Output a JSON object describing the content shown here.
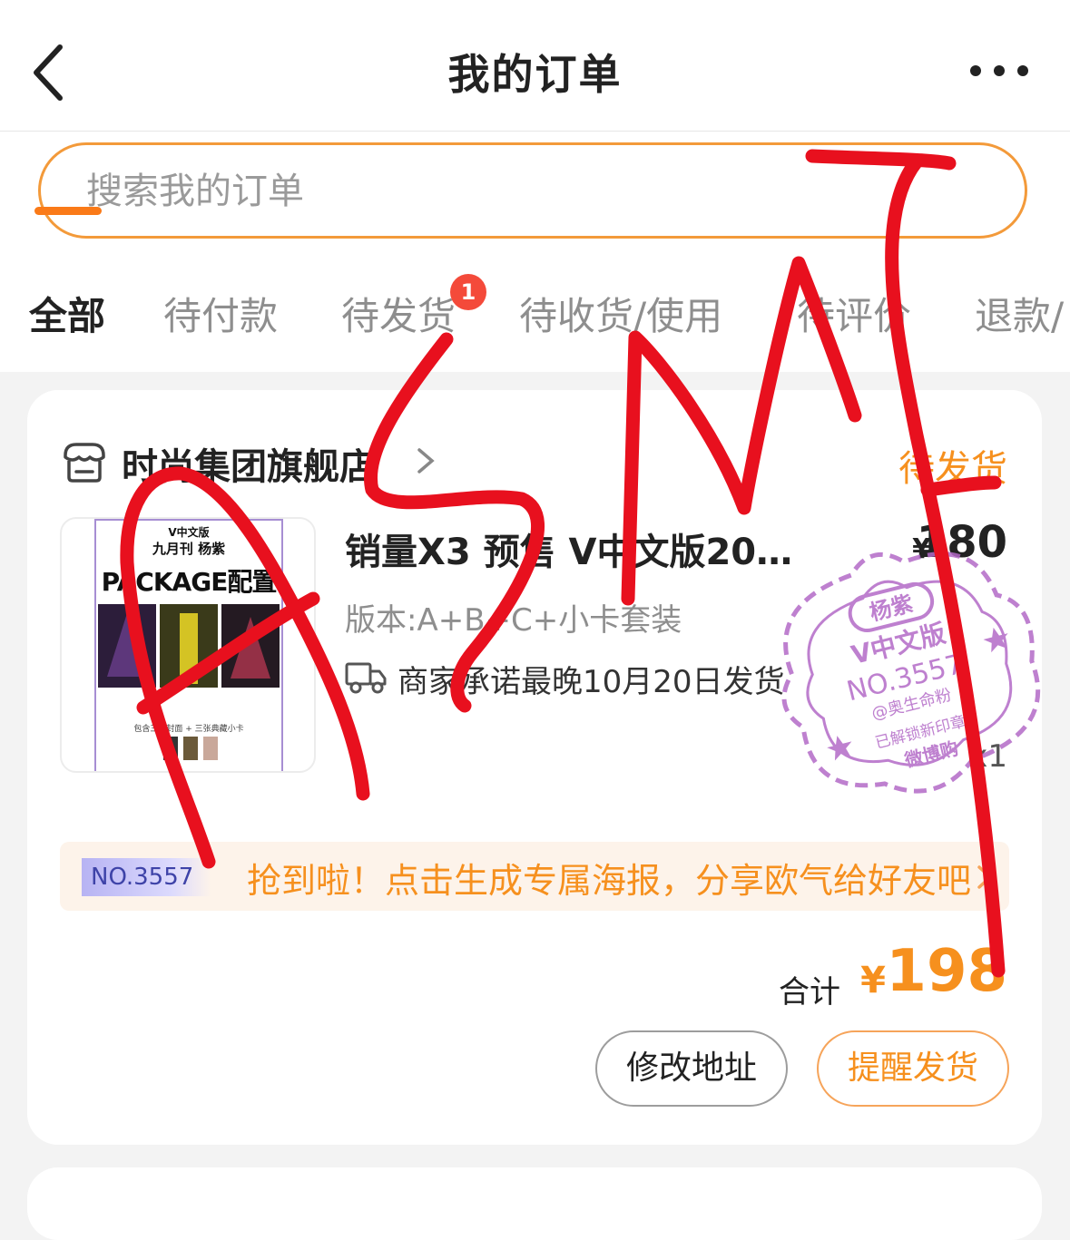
{
  "header": {
    "title": "我的订单",
    "back_icon": "chevron-left-icon",
    "more_icon": "more-dots-icon"
  },
  "search": {
    "placeholder": "搜索我的订单",
    "value": ""
  },
  "tabs": [
    {
      "label": "全部",
      "active": true
    },
    {
      "label": "待付款",
      "active": false
    },
    {
      "label": "待发货",
      "active": false,
      "badge": "1"
    },
    {
      "label": "待收货/使用",
      "active": false
    },
    {
      "label": "待评价",
      "active": false
    },
    {
      "label": "退款/",
      "active": false
    }
  ],
  "order": {
    "shop_name": "时尚集团旗舰店",
    "status": "待发货",
    "product": {
      "title": "销量X3 预售 V中文版20…",
      "price_unit": "¥",
      "price": "180",
      "spec": "版本:A+B+C+小卡套装",
      "shipping_note": "商家承诺最晚10月20日发货",
      "quantity": "x1",
      "poster": {
        "line1": "V中文版",
        "line2": "九月刊 杨紫",
        "headline": "PACKAGE配置说明",
        "note": "包含三款封面 + 三张典藏小卡"
      }
    },
    "stamp": {
      "name": "杨紫",
      "edition": "V中文版",
      "number": "NO.3557",
      "fan_handle": "@奥生命粉",
      "unlock_text": "已解锁新印章",
      "brand": "微博购"
    },
    "promo": {
      "tag": "NO.3557",
      "text": "抢到啦！点击生成专属海报，分享欧气给好友吧"
    },
    "total_label": "合计",
    "total_unit": "¥",
    "total": "198",
    "buttons": {
      "edit_address": "修改地址",
      "remind_ship": "提醒发货"
    }
  },
  "overlay": {
    "handwriting": "ASMT",
    "color": "#e8101e"
  },
  "colors": {
    "accent": "#f6901e",
    "tab_underline": "#fa7a18",
    "badge": "#f44a3a",
    "stamp": "#b36ac7"
  }
}
